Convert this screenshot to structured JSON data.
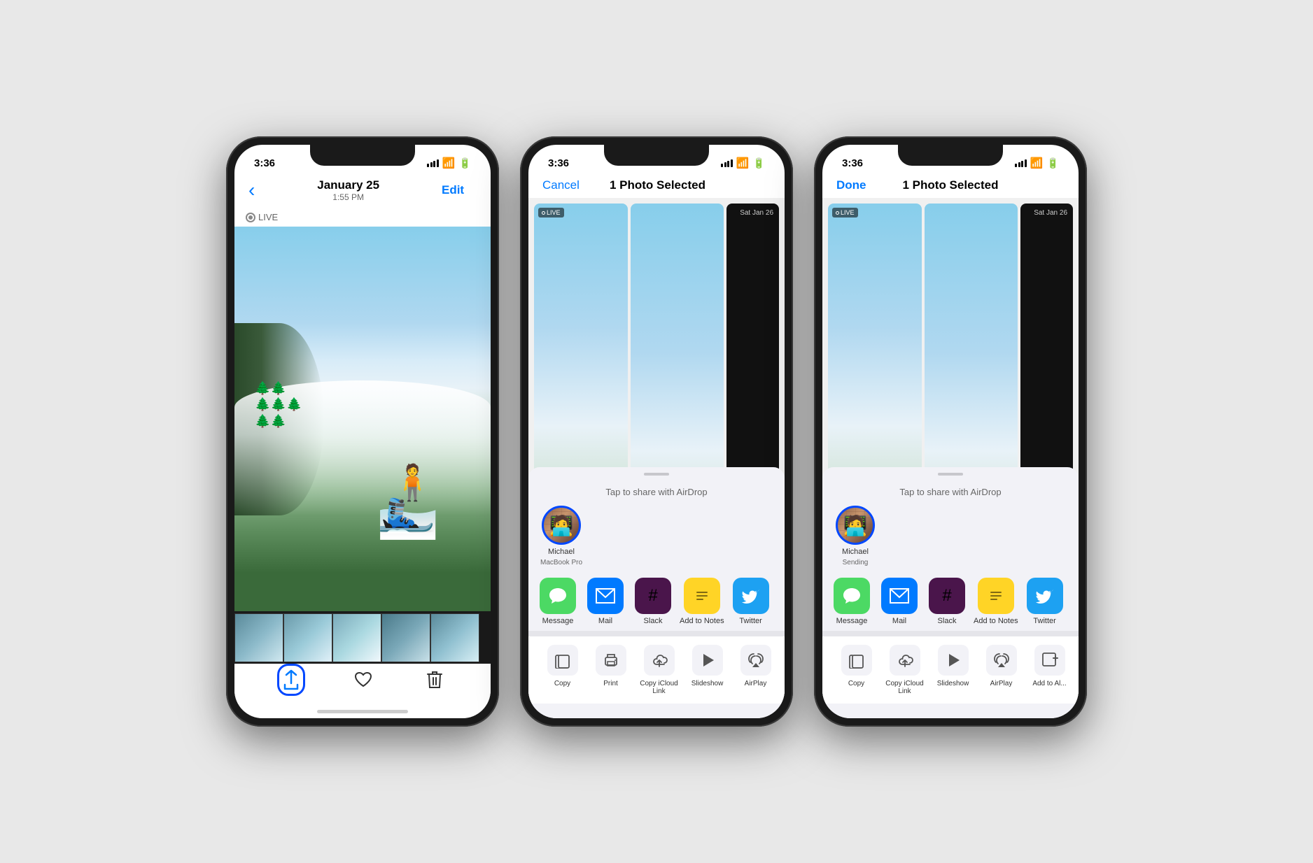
{
  "colors": {
    "ios_blue": "#007AFF",
    "highlight_blue": "#0047FF",
    "green": "#4CD964",
    "dark": "#1a1a1a"
  },
  "phone1": {
    "status": {
      "time": "3:36",
      "location_icon": "▶",
      "signal": "●●●",
      "wifi": "wifi",
      "battery": "battery"
    },
    "nav": {
      "back_label": "‹",
      "title": "January 25",
      "subtitle": "1:55 PM",
      "edit_btn": "Edit"
    },
    "live_badge": "LIVE",
    "toolbar": {
      "share_label": "share",
      "heart_label": "♡",
      "trash_label": "🗑"
    }
  },
  "phone2": {
    "status": {
      "time": "3:36",
      "location_icon": "▶"
    },
    "nav": {
      "cancel_btn": "Cancel",
      "title": "1 Photo Selected"
    },
    "airdrop_hint": "Tap to share with AirDrop",
    "contact": {
      "name": "Michael",
      "device": "MacBook Pro"
    },
    "apps": [
      {
        "name": "Message",
        "icon": "messages"
      },
      {
        "name": "Mail",
        "icon": "mail"
      },
      {
        "name": "Slack",
        "icon": "slack"
      },
      {
        "name": "Add to Notes",
        "icon": "notes"
      },
      {
        "name": "Twitter",
        "icon": "twitter"
      }
    ],
    "actions": [
      {
        "name": "Copy",
        "icon": "📋"
      },
      {
        "name": "Print",
        "icon": "🖨"
      },
      {
        "name": "Copy iCloud Link",
        "icon": "🔗"
      },
      {
        "name": "Slideshow",
        "icon": "▶"
      },
      {
        "name": "AirPlay",
        "icon": "📡"
      }
    ]
  },
  "phone3": {
    "status": {
      "time": "3:36",
      "location_icon": "▶"
    },
    "nav": {
      "done_btn": "Done",
      "title": "1 Photo Selected"
    },
    "airdrop_hint": "Tap to share with AirDrop",
    "contact": {
      "name": "Michael",
      "device": "Sending"
    },
    "apps": [
      {
        "name": "Message",
        "icon": "messages"
      },
      {
        "name": "Mail",
        "icon": "mail"
      },
      {
        "name": "Slack",
        "icon": "slack"
      },
      {
        "name": "Add to Notes",
        "icon": "notes"
      },
      {
        "name": "Twitter",
        "icon": "twitter"
      }
    ],
    "actions": [
      {
        "name": "Copy",
        "icon": "📋"
      },
      {
        "name": "Copy iCloud Link",
        "icon": "🔗"
      },
      {
        "name": "Slideshow",
        "icon": "▶"
      },
      {
        "name": "AirPlay",
        "icon": "📡"
      },
      {
        "name": "Add to Al...",
        "icon": "➕"
      }
    ]
  }
}
